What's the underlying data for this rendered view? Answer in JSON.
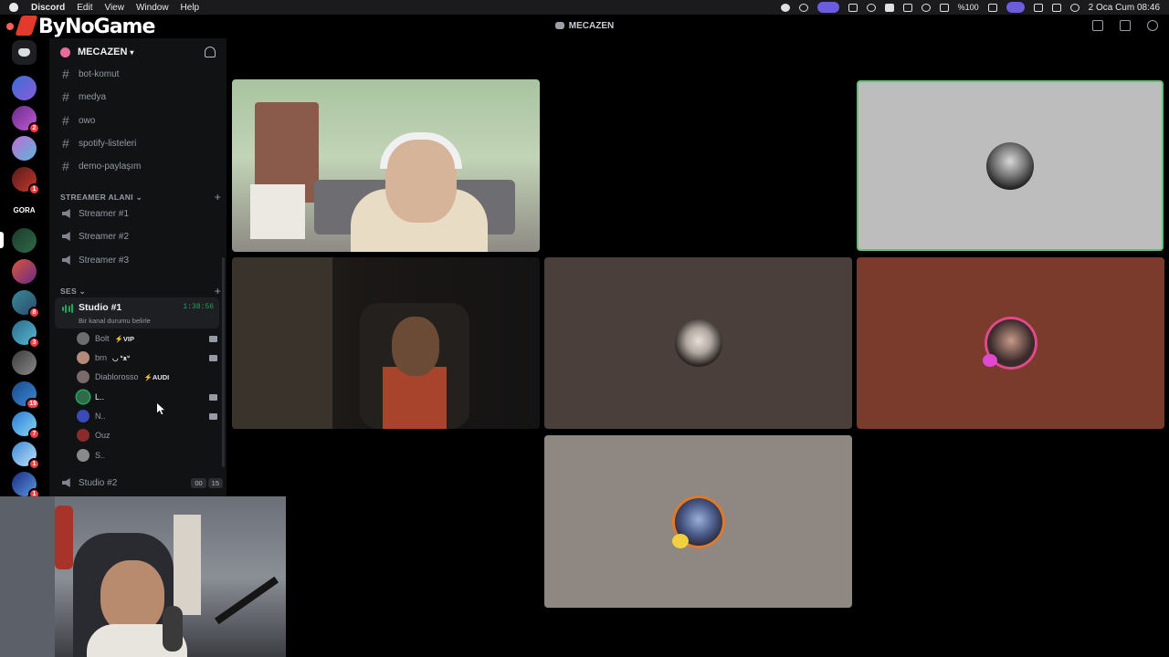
{
  "menubar": {
    "items": [
      "Discord",
      "Edit",
      "View",
      "Window",
      "Help"
    ],
    "battery": "%100",
    "datetime": "2 Oca Cum  08:46"
  },
  "overlay_brand": "ByNoGame",
  "window": {
    "title": "MECAZEN"
  },
  "rail": {
    "badges": [
      "2",
      "1",
      "8",
      "3",
      "19",
      "7",
      "1",
      "1"
    ],
    "text_server": "GORA"
  },
  "sidebar": {
    "guild_name": "MECAZEN",
    "text_channels": [
      "bot-komut",
      "medya",
      "owo",
      "spotify-listeleri",
      "demo-paylaşım"
    ],
    "category_streamer": "STREAMER ALANI",
    "streamer_channels": [
      "Streamer #1",
      "Streamer #2",
      "Streamer #3"
    ],
    "category_ses": "SES",
    "active_channel": {
      "name": "Studio #1",
      "timer": "1:38:56",
      "status": "Bir kanal durumu belirle"
    },
    "voice_users": [
      {
        "name": "Bolt",
        "tag": "⚡VIP"
      },
      {
        "name": "brn",
        "tag": "◡ ᐡᴥᐡ"
      },
      {
        "name": "Diablorosso",
        "tag": "⚡AUDI"
      },
      {
        "name": "L..",
        "tag": ""
      },
      {
        "name": "N..",
        "tag": ""
      },
      {
        "name": "Ouz",
        "tag": ""
      },
      {
        "name": "S..",
        "tag": ""
      }
    ],
    "studio2": {
      "name": "Studio #2",
      "count_a": "00",
      "count_b": "15"
    }
  },
  "colors": {
    "accent_green": "#23a55a",
    "speaking_border": "#5fbf7a",
    "badge_red": "#f23f43",
    "brand_red": "#e23b2c"
  }
}
